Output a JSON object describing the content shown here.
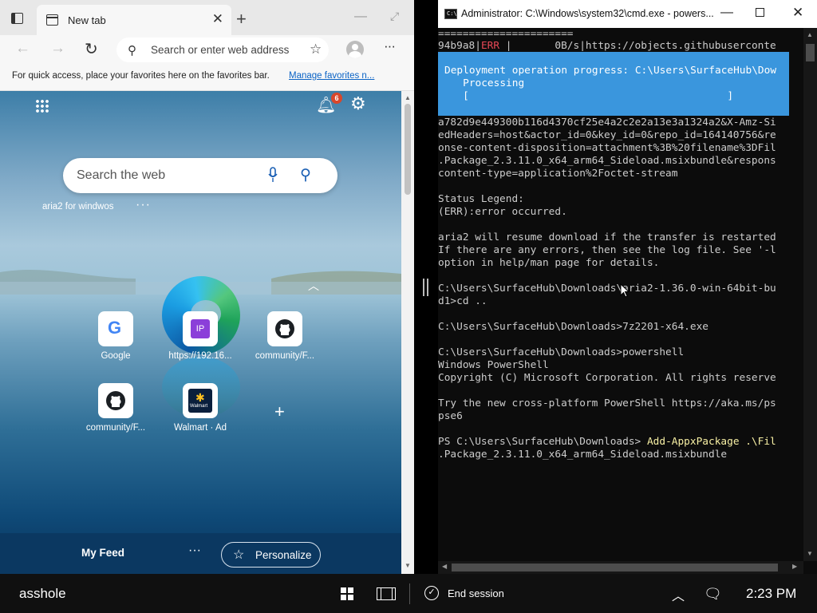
{
  "browser": {
    "tab": {
      "label": "New tab"
    },
    "address": {
      "placeholder": "Search or enter web address"
    },
    "favorites_bar": {
      "text": "For quick access, place your favorites here on the favorites bar.",
      "link": "Manage favorites n..."
    },
    "ntp": {
      "notification_count": "6",
      "search_placeholder": "Search the web",
      "quick_link_text": "aria2 for windwos",
      "tiles": [
        {
          "label": "Google",
          "icon": "google-icon"
        },
        {
          "label": "https://192.16...",
          "icon": "ip-icon",
          "badge": "IP"
        },
        {
          "label": "community/F...",
          "icon": "github-icon"
        },
        {
          "label": "community/F...",
          "icon": "github-icon"
        },
        {
          "label": "Walmart · Ad",
          "icon": "walmart-icon",
          "badge": "Walmart"
        }
      ],
      "feed": {
        "title": "My Feed",
        "personalize": "Personalize"
      }
    }
  },
  "cmd": {
    "title": "Administrator: C:\\Windows\\system32\\cmd.exe - powers...",
    "icon_glyph": "C:\\",
    "progress": {
      "line1": "Deployment operation progress: C:\\Users\\SurfaceHub\\Dow",
      "line2": "   Processing",
      "line3": "   [                                          ]"
    },
    "lines": [
      "======================",
      "a782d9e449300b116d4370cf25e4a2c2e2a13e3a1324a2&X-Amz-Si",
      "edHeaders=host&actor_id=0&key_id=0&repo_id=164140756&re",
      "onse-content-disposition=attachment%3B%20filename%3DFil",
      ".Package_2.3.11.0_x64_arm64_Sideload.msixbundle&respons",
      "content-type=application%2Foctet-stream",
      "Status Legend:",
      "(ERR):error occurred.",
      "aria2 will resume download if the transfer is restarted",
      "If there are any errors, then see the log file. See '-l",
      "option in help/man page for details.",
      "C:\\Users\\SurfaceHub\\Downloads\\aria2-1.36.0-win-64bit-bu",
      "d1>cd ..",
      "C:\\Users\\SurfaceHub\\Downloads>7z2201-x64.exe",
      "C:\\Users\\SurfaceHub\\Downloads>powershell",
      "Windows PowerShell",
      "Copyright (C) Microsoft Corporation. All rights reserve",
      "Try the new cross-platform PowerShell https://aka.ms/ps",
      "pse6",
      "PS C:\\Users\\SurfaceHub\\Downloads> ",
      ".Package_2.3.11.0_x64_arm64_Sideload.msixbundle"
    ],
    "err_row": {
      "id": "94b9a8|",
      "tag": "ERR",
      "rest": " |       0B/s|https://objects.githubuserconte"
    },
    "ps_command": "Add-AppxPackage .\\Fil"
  },
  "taskbar": {
    "user": "asshole",
    "end_session": "End session",
    "time": "2:23 PM"
  },
  "colors": {
    "progress_bg": "#3a96dd",
    "error_red": "#e74856",
    "ps_command_yellow": "#f9f1a5"
  }
}
